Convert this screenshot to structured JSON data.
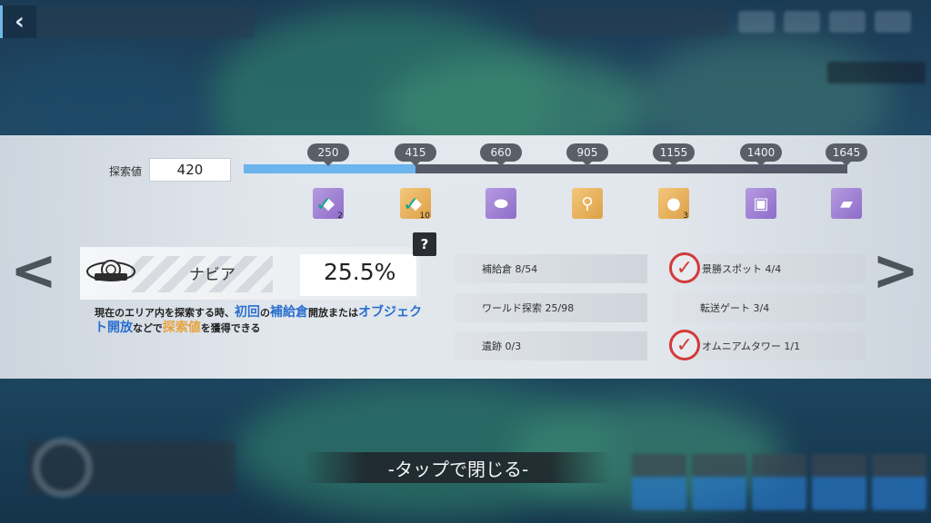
{
  "header": {
    "back_icon": "chevron-left-icon"
  },
  "explore": {
    "label": "探索値",
    "value": "420",
    "current": 420,
    "max": 1645,
    "milestones": [
      "250",
      "415",
      "660",
      "905",
      "1155",
      "1400",
      "1645"
    ],
    "milestone_values": [
      250,
      415,
      660,
      905,
      1155,
      1400,
      1645
    ]
  },
  "rewards": [
    {
      "icon": "check-chip-icon",
      "count": "2",
      "rarity": "purple",
      "claimed": true
    },
    {
      "icon": "crystal-chip-icon",
      "count": "10",
      "rarity": "gold",
      "claimed": true
    },
    {
      "icon": "device-icon",
      "count": "",
      "rarity": "purple",
      "claimed": false
    },
    {
      "icon": "mushroom-icon",
      "count": "",
      "rarity": "gold",
      "claimed": false
    },
    {
      "icon": "orb-icon",
      "count": "3",
      "rarity": "gold",
      "claimed": false
    },
    {
      "icon": "jacket-icon",
      "count": "",
      "rarity": "purple",
      "claimed": false
    },
    {
      "icon": "card-icon",
      "count": "",
      "rarity": "purple",
      "claimed": false
    }
  ],
  "area": {
    "name": "ナビア",
    "percent": "25.5%",
    "help": "?",
    "description": {
      "part1": "現在のエリア内を探索する時、",
      "hl1": "初回",
      "part2": "の",
      "hl2": "補給倉",
      "part3": "開放または",
      "hl3": "オブジェクト開放",
      "part4": "などで",
      "hl4": "探索値",
      "part5": "を獲得できる"
    }
  },
  "stats_left": [
    {
      "label": "補給倉  8/54"
    },
    {
      "label": "ワールド探索  25/98"
    },
    {
      "label": "遺跡  0/3"
    }
  ],
  "stats_right": [
    {
      "label": "景勝スポット  4/4",
      "checked": true
    },
    {
      "label": "転送ゲート  3/4",
      "checked": false
    },
    {
      "label": "オムニアムタワー  1/1",
      "checked": true
    }
  ],
  "footer": {
    "close_hint": "-タップで閉じる-"
  },
  "colors": {
    "progress_fill": "#6cb4ee",
    "progress_track": "#545b66",
    "highlight_blue": "#2a6fcf",
    "highlight_gold": "#e7a33c",
    "check_red": "#d23a3a"
  }
}
